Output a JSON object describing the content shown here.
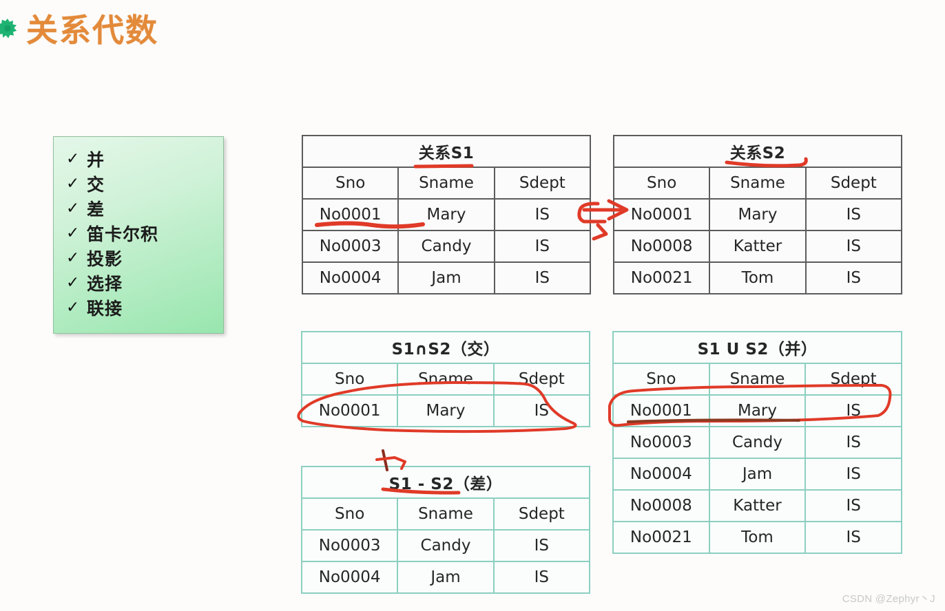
{
  "title": {
    "text": "关系代数",
    "bullet_icon": "green-star-icon",
    "color": "#e38a3a"
  },
  "ops_box": {
    "check_glyph": "✓",
    "accent_color": "#98e6ae",
    "items": [
      {
        "label": "并"
      },
      {
        "label": "交"
      },
      {
        "label": "差"
      },
      {
        "label": "笛卡尔积"
      },
      {
        "label": "投影"
      },
      {
        "label": "选择"
      },
      {
        "label": "联接"
      }
    ]
  },
  "tables": {
    "s1": {
      "caption": "关系S1",
      "headers": [
        "Sno",
        "Sname",
        "Sdept"
      ],
      "rows": [
        [
          "No0001",
          "Mary",
          "IS"
        ],
        [
          "No0003",
          "Candy",
          "IS"
        ],
        [
          "No0004",
          "Jam",
          "IS"
        ]
      ]
    },
    "s2": {
      "caption": "关系S2",
      "headers": [
        "Sno",
        "Sname",
        "Sdept"
      ],
      "rows": [
        [
          "No0001",
          "Mary",
          "IS"
        ],
        [
          "No0008",
          "Katter",
          "IS"
        ],
        [
          "No0021",
          "Tom",
          "IS"
        ]
      ]
    },
    "intersection": {
      "caption": "S1∩S2（交）",
      "headers": [
        "Sno",
        "Sname",
        "Sdept"
      ],
      "rows": [
        [
          "No0001",
          "Mary",
          "IS"
        ]
      ]
    },
    "union": {
      "caption": "S1 U S2（并）",
      "headers": [
        "Sno",
        "Sname",
        "Sdept"
      ],
      "rows": [
        [
          "No0001",
          "Mary",
          "IS"
        ],
        [
          "No0003",
          "Candy",
          "IS"
        ],
        [
          "No0004",
          "Jam",
          "IS"
        ],
        [
          "No0008",
          "Katter",
          "IS"
        ],
        [
          "No0021",
          "Tom",
          "IS"
        ]
      ]
    },
    "difference": {
      "caption": "S1 - S2（差）",
      "headers": [
        "Sno",
        "Sname",
        "Sdept"
      ],
      "rows": [
        [
          "No0003",
          "Candy",
          "IS"
        ],
        [
          "No0004",
          "Jam",
          "IS"
        ]
      ]
    }
  },
  "annotations": {
    "ink_color": "#e03a28",
    "marks": [
      "underline-s1-sname",
      "underline-s1-no0001-row",
      "arrow-s1-to-s2",
      "underline-s2-caption",
      "circle-intersection-row",
      "circle-union-no0001-row",
      "tick-above-difference-caption",
      "underline-difference-caption"
    ]
  },
  "watermark": {
    "text": "CSDN @Zephyr丶J"
  }
}
